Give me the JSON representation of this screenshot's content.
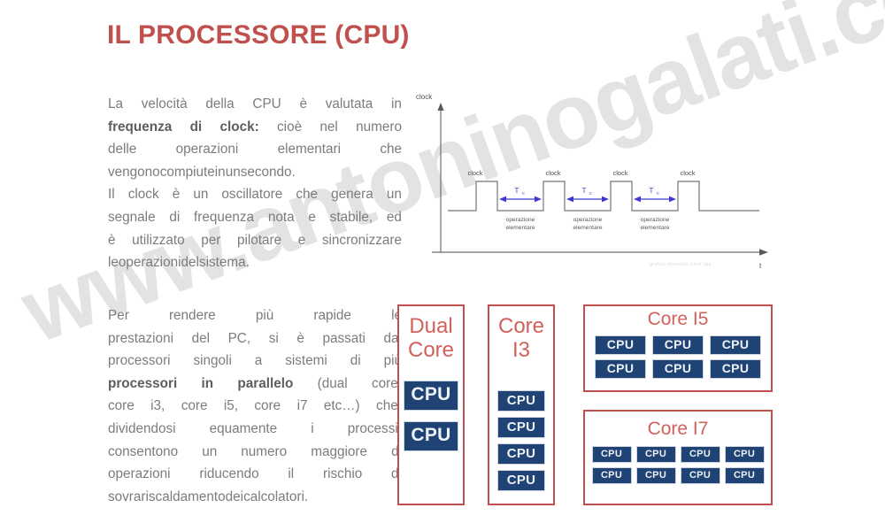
{
  "slide": {
    "title": "IL PROCESSORE (CPU)",
    "title_color": "#C0504D",
    "watermark": "www.antoninogalati.com",
    "background": "#FFFFFF"
  },
  "text_blocks": [
    {
      "id": "para-block-1",
      "lines": [
        "La velocità della CPU è valutata in",
        "frequenza di clock: cioè nel numero",
        "delle operazioni elementari che",
        "vengono compiute in un secondo.",
        "Il clock è un oscillatore che genera un",
        "segnale di frequenza nota e stabile, ed",
        "è utilizzato per pilotare e sincronizzare",
        "le operazioni del sistema."
      ],
      "bold_fragment": "frequenza di clock"
    },
    {
      "id": "para-block-2",
      "lines": [
        "Per rendere più rapide le",
        "prestazioni del PC, si è passati dai",
        "processori singoli a sistemi di più",
        "processori in parallelo (dual core,",
        "core i3, core i5, core i7 etc…) che,",
        "dividendosi equamente i processi,",
        "consentono un numero maggiore di",
        "operazioni riducendo il rischio di",
        "sovrariscaldamento dei calcolatori."
      ],
      "bold_fragment": "processori in parallelo"
    }
  ],
  "clock_diagram": {
    "y_axis_label": "clock",
    "x_axis_label": "t",
    "pulse_labels": [
      "clock",
      "clock",
      "clock",
      "clock"
    ],
    "period_label": "T",
    "period_subscript": "c",
    "period_count": 3,
    "operation_label_line1": "operazione",
    "operation_label_line2": "elementare",
    "operation_count": 3,
    "caption_faded": "grafico intervallo clock cpu",
    "wave_color": "#8a8a8a",
    "arrow_color": "#3B3BD4",
    "axis_color": "#6e6e6e"
  },
  "core_panels": [
    {
      "id": "panel-dual",
      "title_lines": [
        "Dual",
        "Core"
      ],
      "cpu_label": "CPU",
      "cpu_count": 2,
      "border_color": "#C0504D",
      "chip_color": "#1F4374"
    },
    {
      "id": "panel-i3",
      "title_lines": [
        "Core",
        "I3"
      ],
      "cpu_label": "CPU",
      "cpu_count": 4,
      "border_color": "#C0504D",
      "chip_color": "#1F4374"
    },
    {
      "id": "panel-i5",
      "title_lines": [
        "Core I5"
      ],
      "cpu_label": "CPU",
      "cpu_count": 6,
      "border_color": "#C0504D",
      "chip_color": "#1F4374"
    },
    {
      "id": "panel-i7",
      "title_lines": [
        "Core I7"
      ],
      "cpu_label": "CPU",
      "cpu_count": 8,
      "border_color": "#C0504D",
      "chip_color": "#1F4374"
    }
  ]
}
